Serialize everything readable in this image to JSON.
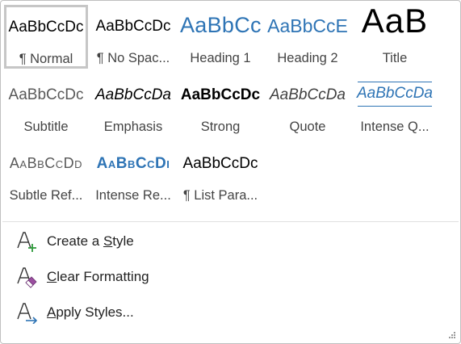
{
  "gallery": {
    "styles": [
      {
        "preview": "AaBbCcDc",
        "name": "¶ Normal",
        "selected": true
      },
      {
        "preview": "AaBbCcDc",
        "name": "¶ No Spac..."
      },
      {
        "preview": "AaBbCc",
        "name": "Heading 1"
      },
      {
        "preview": "AaBbCcE",
        "name": "Heading 2"
      },
      {
        "preview": "AaB",
        "name": "Title"
      },
      {
        "preview": "AaBbCcDc",
        "name": "Subtitle"
      },
      {
        "preview": "AaBbCcDa",
        "name": "Emphasis"
      },
      {
        "preview": "AaBbCcDc",
        "name": "Strong"
      },
      {
        "preview": "AaBbCcDa",
        "name": "Quote"
      },
      {
        "preview": "AaBbCcDa",
        "name": "Intense Q..."
      },
      {
        "preview": "AaBbCcDd",
        "name": "Subtle Ref..."
      },
      {
        "preview": "AaBbCcDı",
        "name": "Intense Re..."
      },
      {
        "preview": "AaBbCcDc",
        "name": "¶ List Para..."
      }
    ]
  },
  "menu": {
    "create_style": {
      "before": "Create a ",
      "accel": "S",
      "after": "tyle",
      "icon": "create-style-icon"
    },
    "clear_formatting": {
      "before": "",
      "accel": "C",
      "after": "lear Formatting",
      "icon": "clear-formatting-icon"
    },
    "apply_styles": {
      "before": "",
      "accel": "A",
      "after": "pply Styles...",
      "icon": "apply-styles-icon"
    }
  },
  "colors": {
    "heading_blue": "#2e74b5",
    "create_plus": "#2e9a3a",
    "eraser_purple": "#9b4fa0",
    "apply_arrow": "#2e74b5"
  }
}
